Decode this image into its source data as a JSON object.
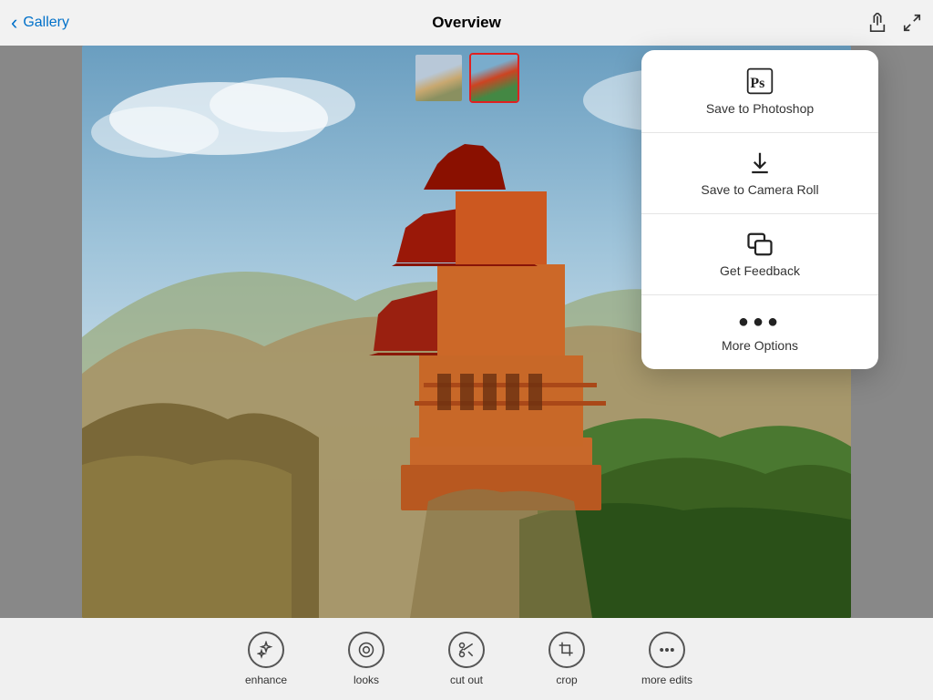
{
  "header": {
    "back_label": "Gallery",
    "title": "Overview"
  },
  "thumbnails": [
    {
      "id": "thumb1",
      "label": "Landscape thumbnail",
      "active": false
    },
    {
      "id": "thumb2",
      "label": "Temple thumbnail",
      "active": true
    }
  ],
  "popup": {
    "items": [
      {
        "id": "save-photoshop",
        "label": "Save to Photoshop",
        "icon": "ps"
      },
      {
        "id": "save-camera",
        "label": "Save to Camera Roll",
        "icon": "download"
      },
      {
        "id": "get-feedback",
        "label": "Get Feedback",
        "icon": "feedback"
      },
      {
        "id": "more-options",
        "label": "More Options",
        "icon": "ellipsis"
      }
    ]
  },
  "toolbar": {
    "items": [
      {
        "id": "enhance",
        "label": "enhance",
        "icon": "sparkle"
      },
      {
        "id": "looks",
        "label": "looks",
        "icon": "looks"
      },
      {
        "id": "cut-out",
        "label": "cut out",
        "icon": "scissors"
      },
      {
        "id": "crop",
        "label": "crop",
        "icon": "crop"
      },
      {
        "id": "more-edits",
        "label": "more edits",
        "icon": "dots"
      }
    ]
  },
  "icons": {
    "share": "⬆",
    "expand": "⤢",
    "back": "‹"
  }
}
